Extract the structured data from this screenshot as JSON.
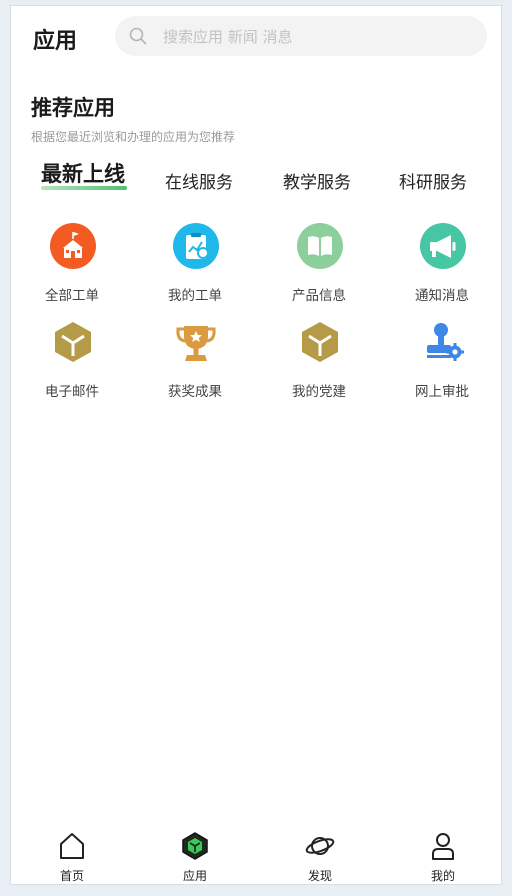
{
  "header": {
    "title": "应用",
    "search_placeholder": "搜索应用 新闻 消息"
  },
  "recommend": {
    "title": "推荐应用",
    "subtitle": "根据您最近浏览和办理的应用为您推荐",
    "tabs": [
      {
        "label": "最新上线",
        "active": true
      },
      {
        "label": "在线服务",
        "active": false
      },
      {
        "label": "教学服务",
        "active": false
      },
      {
        "label": "科研服务",
        "active": false
      }
    ]
  },
  "apps": [
    {
      "label": "全部工单",
      "icon": "school-icon",
      "color": "#f25c22"
    },
    {
      "label": "我的工单",
      "icon": "chart-report-icon",
      "color": "#1fb8e8"
    },
    {
      "label": "产品信息",
      "icon": "book-icon",
      "color": "#8dcf9c"
    },
    {
      "label": "通知消息",
      "icon": "megaphone-icon",
      "color": "#46c6a2"
    },
    {
      "label": "电子邮件",
      "icon": "box-icon",
      "color": "#b59a47"
    },
    {
      "label": "获奖成果",
      "icon": "trophy-icon",
      "color": "#d99a40"
    },
    {
      "label": "我的党建",
      "icon": "box-icon",
      "color": "#b59a47"
    },
    {
      "label": "网上审批",
      "icon": "stamp-gear-icon",
      "color": "#3f87e6"
    }
  ],
  "bottom_nav": [
    {
      "label": "首页",
      "icon": "home-icon"
    },
    {
      "label": "应用",
      "icon": "apps-box-icon",
      "active": true
    },
    {
      "label": "发现",
      "icon": "planet-icon"
    },
    {
      "label": "我的",
      "icon": "user-icon"
    }
  ]
}
